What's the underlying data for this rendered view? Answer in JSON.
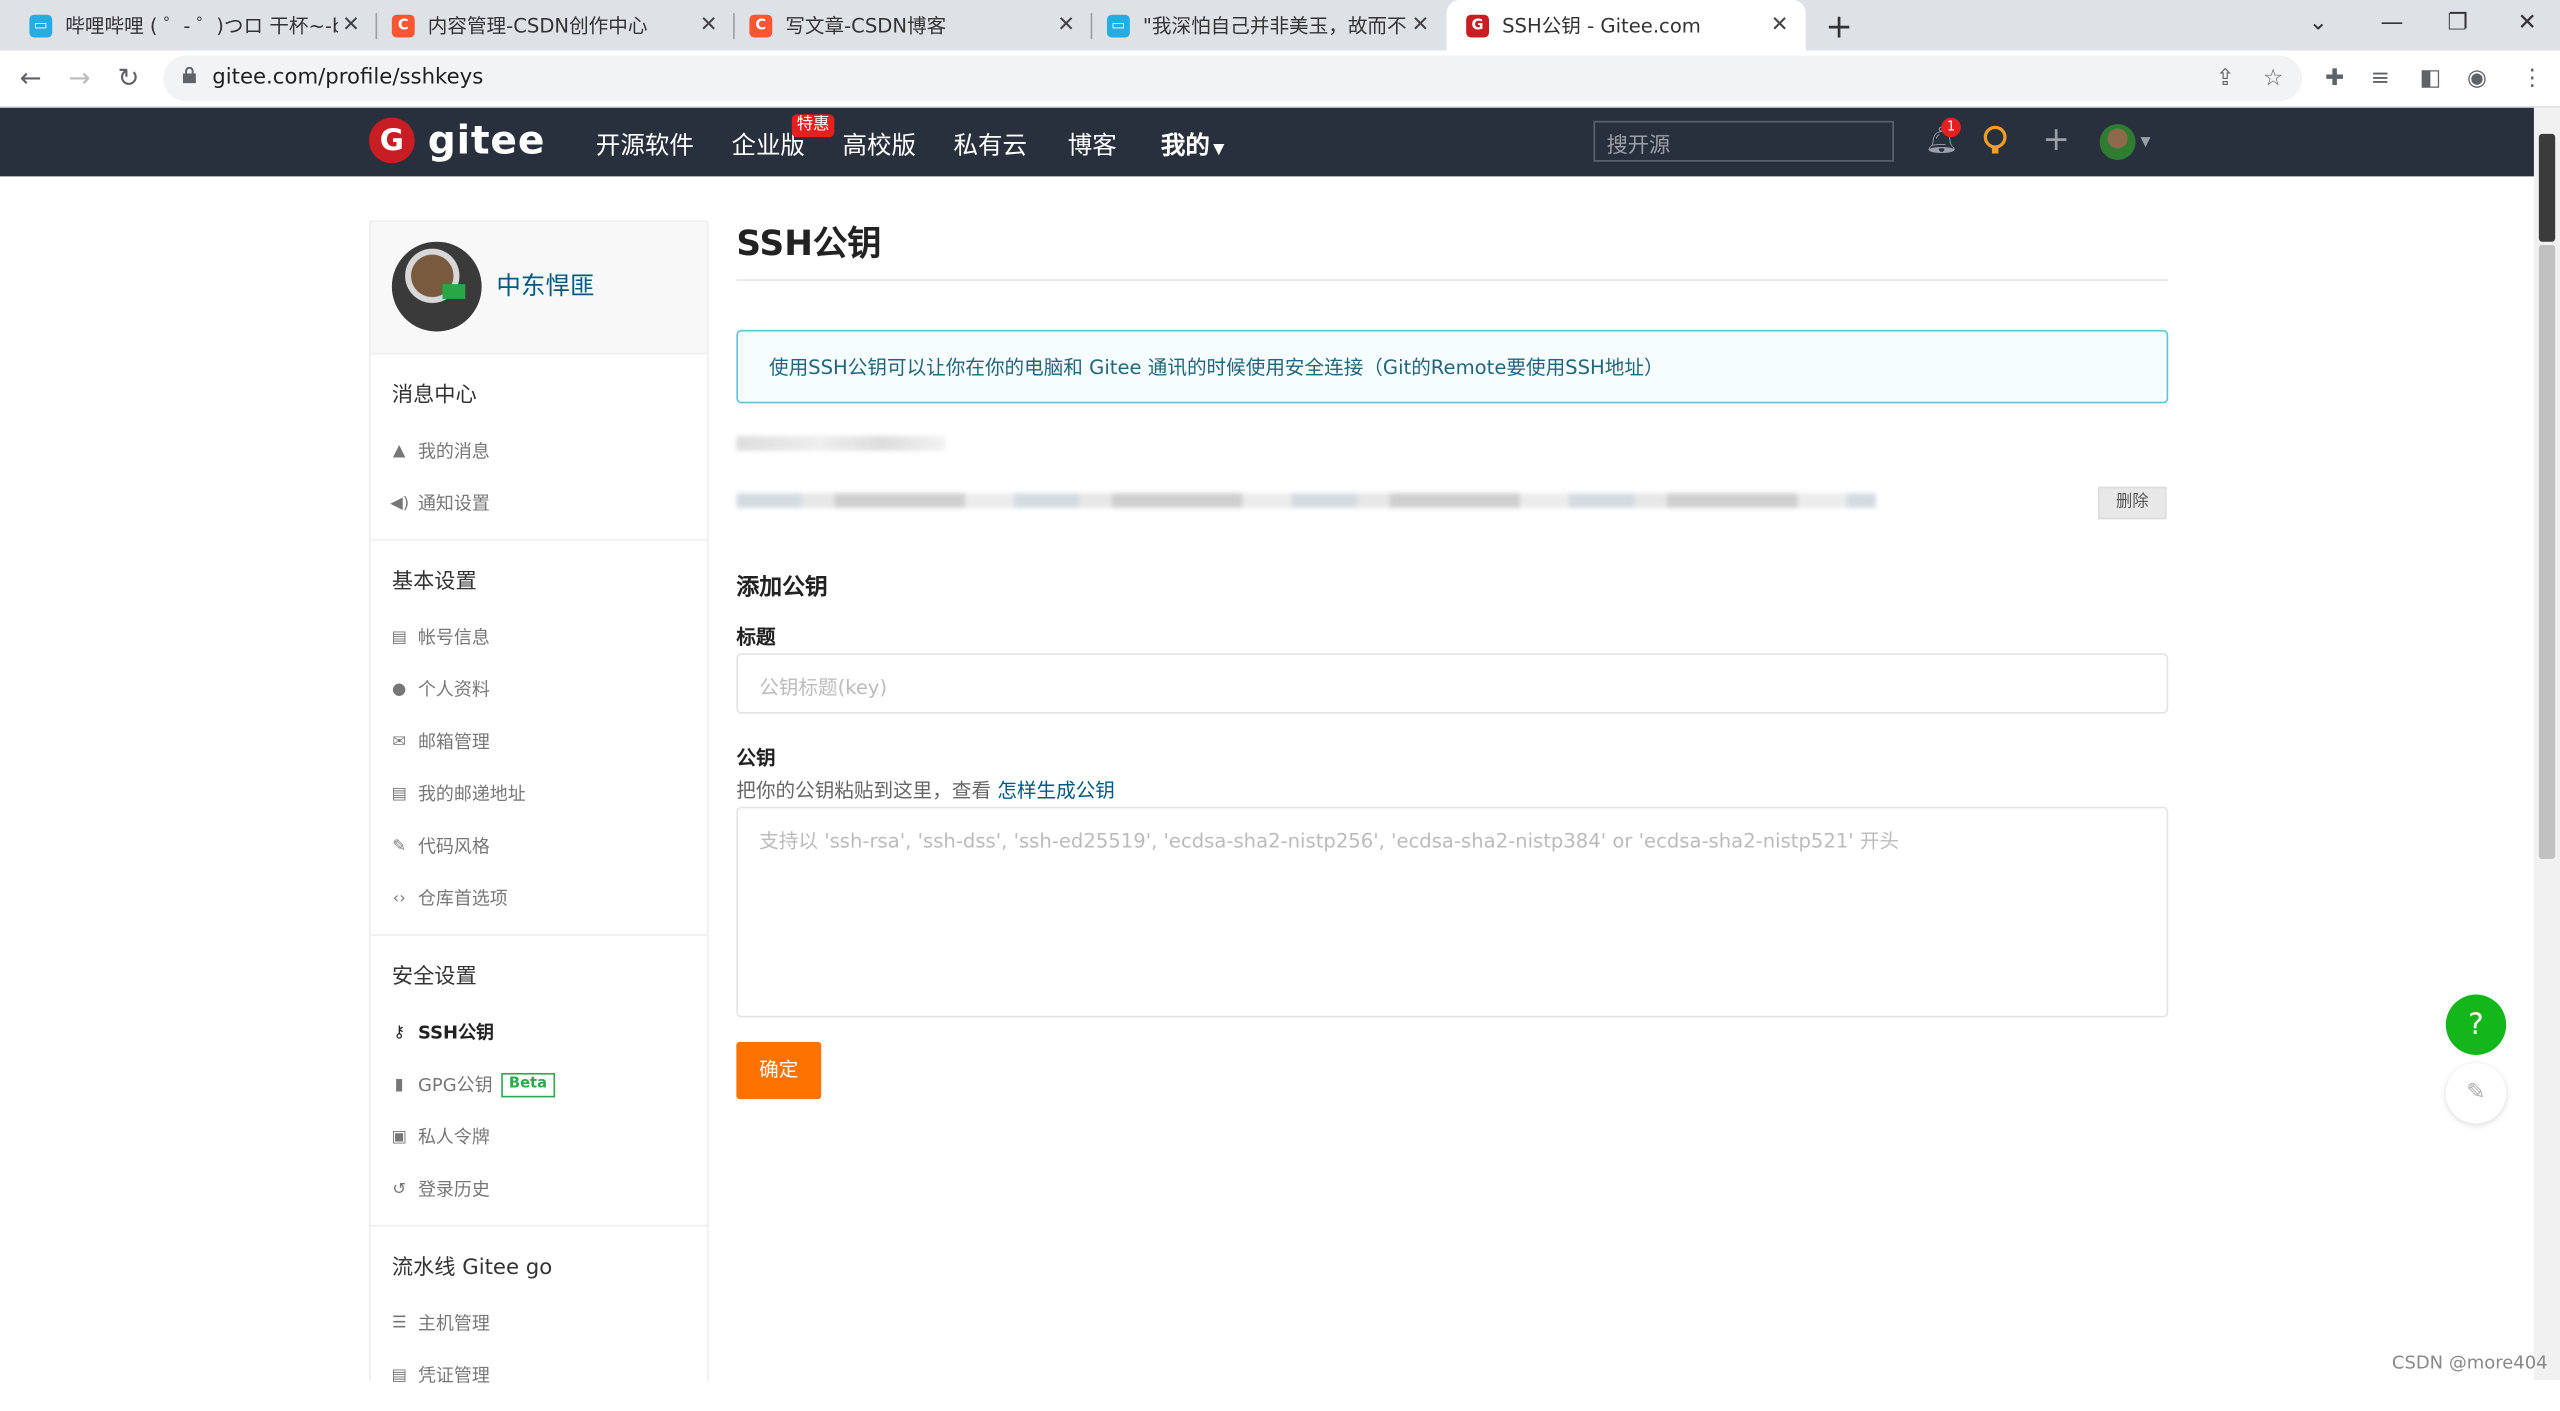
{
  "browser": {
    "tabs": [
      {
        "title": "哔哩哔哩 ( ゜- ゜)つロ 干杯~-bili",
        "icon": "bilibili-icon",
        "color": "#23ade5"
      },
      {
        "title": "内容管理-CSDN创作中心",
        "icon": "csdn-icon",
        "color": "#fc5531"
      },
      {
        "title": "写文章-CSDN博客",
        "icon": "csdn-icon",
        "color": "#fc5531"
      },
      {
        "title": "\"我深怕自己并非美玉，故而不敢",
        "icon": "bilibili-icon",
        "color": "#23ade5"
      },
      {
        "title": "SSH公钥 - Gitee.com",
        "icon": "gitee-icon",
        "color": "#c71d23",
        "active": true
      }
    ],
    "url": "gitee.com/profile/sshkeys"
  },
  "header": {
    "logo_text": "gitee",
    "nav": [
      "开源软件",
      "企业版",
      "高校版",
      "私有云",
      "博客",
      "我的"
    ],
    "promo_badge": "特惠",
    "search_placeholder": "搜开源",
    "notification_count": "1"
  },
  "sidebar": {
    "username": "中东悍匪",
    "groups": [
      {
        "title": "消息中心",
        "items": [
          {
            "label": "我的消息",
            "icon": "bell-icon"
          },
          {
            "label": "通知设置",
            "icon": "speaker-icon"
          }
        ]
      },
      {
        "title": "基本设置",
        "items": [
          {
            "label": "帐号信息",
            "icon": "id-card-icon"
          },
          {
            "label": "个人资料",
            "icon": "user-icon"
          },
          {
            "label": "邮箱管理",
            "icon": "mail-icon"
          },
          {
            "label": "我的邮递地址",
            "icon": "address-card-icon"
          },
          {
            "label": "代码风格",
            "icon": "brush-icon"
          },
          {
            "label": "仓库首选项",
            "icon": "code-icon"
          }
        ]
      },
      {
        "title": "安全设置",
        "items": [
          {
            "label": "SSH公钥",
            "icon": "key-icon",
            "active": true
          },
          {
            "label": "GPG公钥",
            "icon": "lock-icon",
            "badge": "Beta"
          },
          {
            "label": "私人令牌",
            "icon": "token-icon"
          },
          {
            "label": "登录历史",
            "icon": "history-icon"
          }
        ]
      },
      {
        "title": "流水线 Gitee go",
        "items": [
          {
            "label": "主机管理",
            "icon": "server-icon"
          },
          {
            "label": "凭证管理",
            "icon": "credential-icon"
          }
        ]
      }
    ]
  },
  "main": {
    "title": "SSH公钥",
    "info": "使用SSH公钥可以让你在你的电脑和 Gitee 通讯的时候使用安全连接（Git的Remote要使用SSH地址）",
    "delete_label": "删除",
    "add_title": "添加公钥",
    "title_label": "标题",
    "title_placeholder": "公钥标题(key)",
    "key_label": "公钥",
    "key_hint": "把你的公钥粘贴到这里，查看",
    "key_hint_link": "怎样生成公钥",
    "key_placeholder": "支持以 'ssh-rsa', 'ssh-dss', 'ssh-ed25519', 'ecdsa-sha2-nistp256', 'ecdsa-sha2-nistp384' or 'ecdsa-sha2-nistp521' 开头",
    "submit_label": "确定"
  },
  "floating": {
    "help": "?"
  },
  "watermark": "CSDN @more404",
  "colors": {
    "header_bg": "#29303d",
    "accent": "#fe7300",
    "link": "#005980",
    "help": "#13b71c"
  }
}
